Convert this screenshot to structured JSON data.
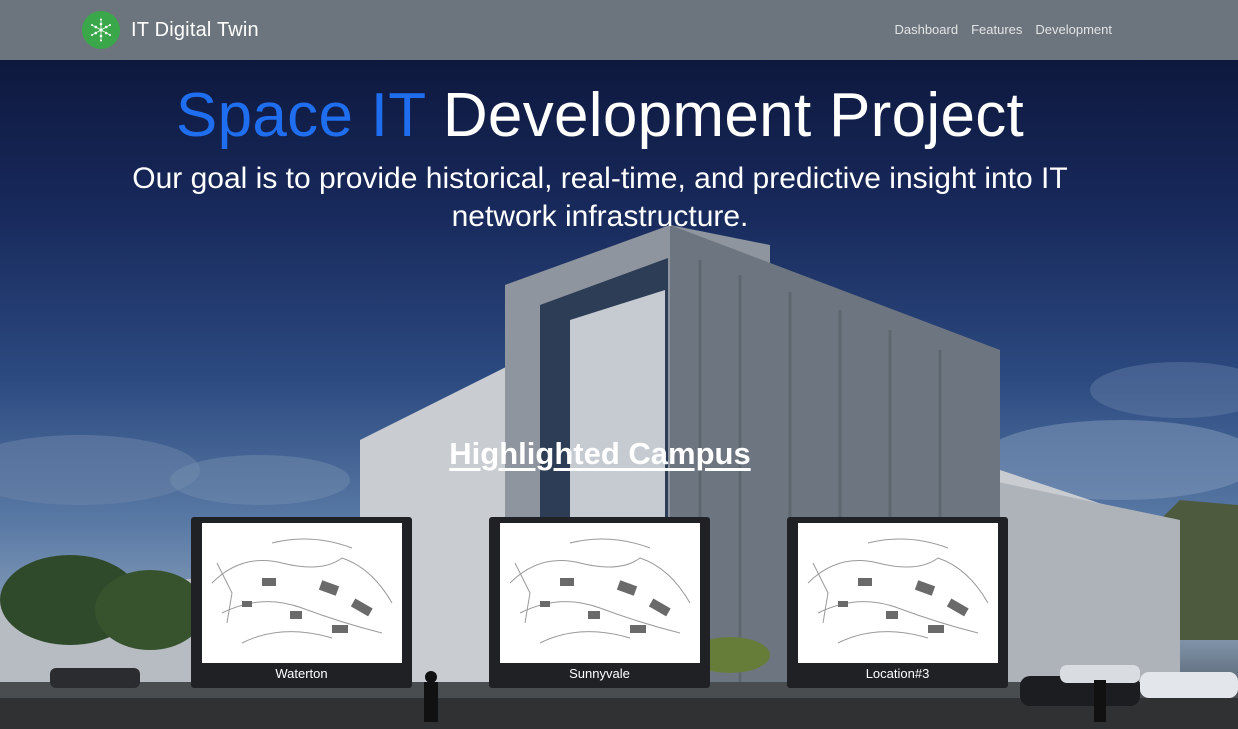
{
  "navbar": {
    "brand_name": "IT Digital Twin",
    "links": [
      {
        "label": "Dashboard"
      },
      {
        "label": "Features"
      },
      {
        "label": "Development"
      }
    ]
  },
  "hero": {
    "title_accent": "Space IT",
    "title_rest": "Development Project",
    "subtitle_line1": "Our goal is to provide historical, real-time, and predictive insight into IT",
    "subtitle_line2": "network infrastructure."
  },
  "campus_section": {
    "title": "Highlighted Campus",
    "cards": [
      {
        "label": "Waterton"
      },
      {
        "label": "Sunnyvale"
      },
      {
        "label": "Location#3"
      }
    ]
  },
  "colors": {
    "navbar": "#6c757d",
    "accent": "#1f6ef0",
    "brand_logo": "#3aa84a",
    "card_bg": "#1f2125"
  }
}
